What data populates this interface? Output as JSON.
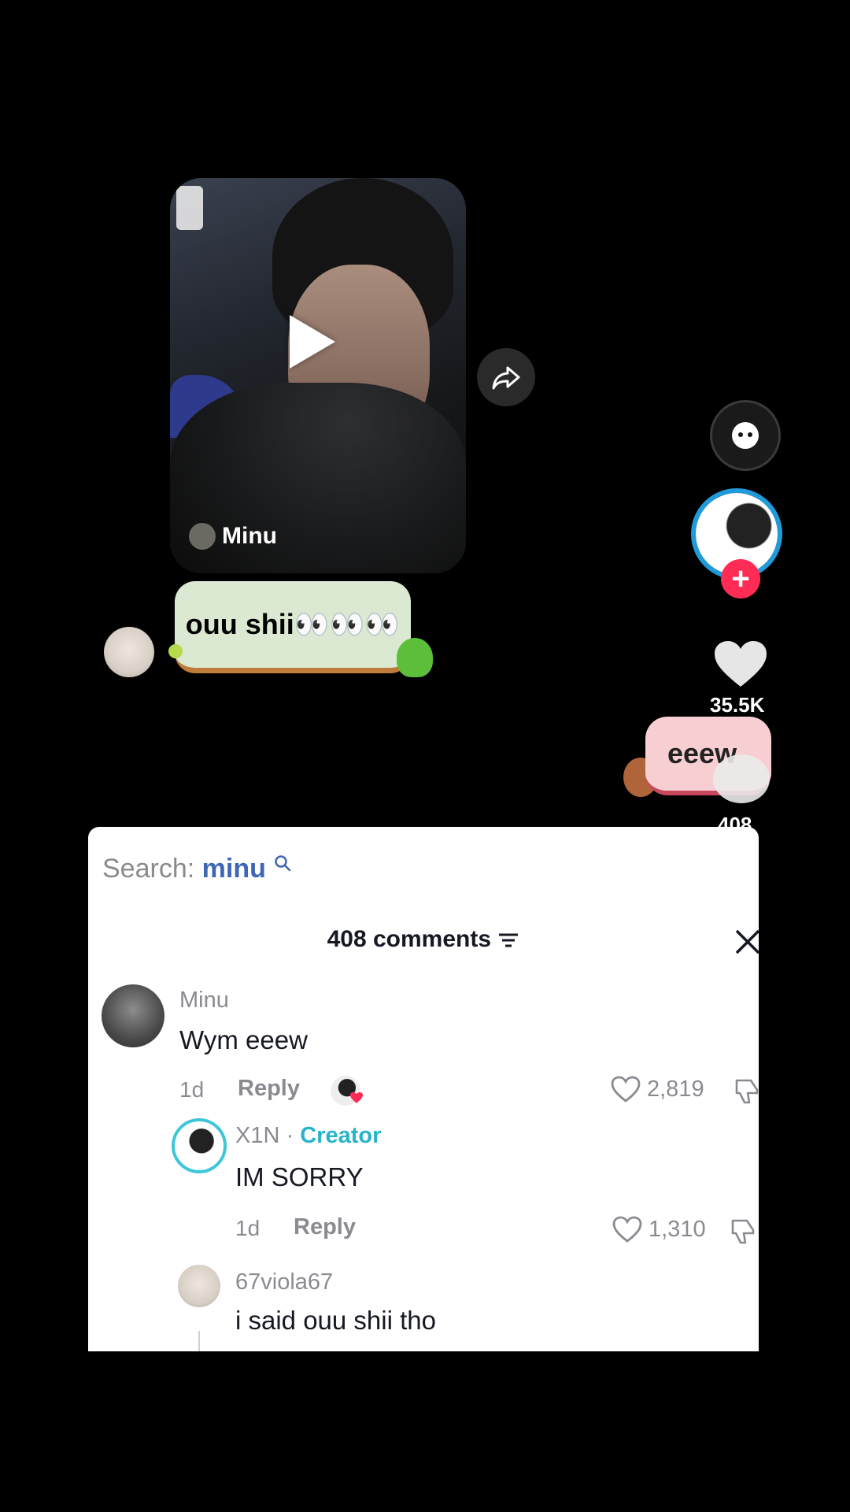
{
  "video": {
    "author": "Minu",
    "play_icon": "play-icon",
    "share_icon": "share-icon"
  },
  "sticker_comment": {
    "text": "ouu shii👀👀👀"
  },
  "right_rail": {
    "like_count": "35.5K",
    "eeew_sticker_text": "eeew",
    "comment_count": "408"
  },
  "comments_sheet": {
    "search_label": "Search:",
    "search_term": "minu",
    "header_title": "408 comments",
    "comments": [
      {
        "username": "Minu",
        "text": "Wym eeew",
        "age": "1d",
        "reply_label": "Reply",
        "likes": "2,819"
      },
      {
        "username": "X1N",
        "creator_separator": "·",
        "creator_label": "Creator",
        "text": "IM SORRY",
        "age": "1d",
        "reply_label": "Reply",
        "likes": "1,310"
      },
      {
        "username": "67viola67",
        "text": "i said ouu shii tho"
      }
    ]
  },
  "colors": {
    "background": "#000000",
    "sheet_background": "#ffffff",
    "search_accent": "#3e66b4",
    "creator_accent": "#27b3c9",
    "follow_red": "#fe2c55",
    "profile_ring_blue": "#1e9bd8"
  }
}
